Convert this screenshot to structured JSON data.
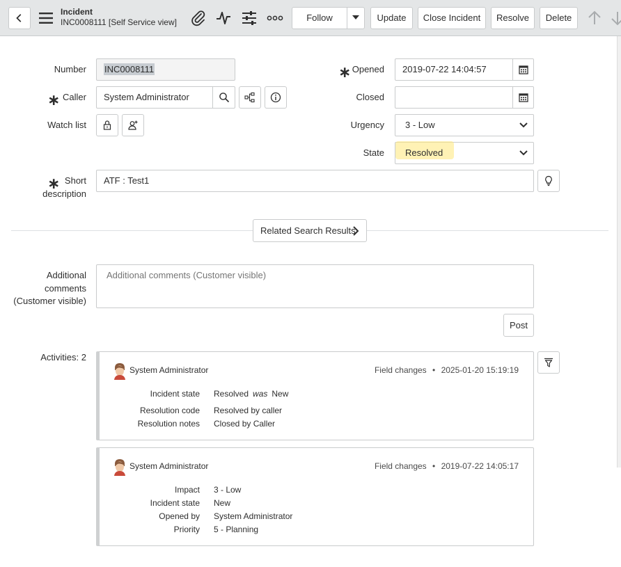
{
  "header": {
    "kind": "Incident",
    "record": "INC0008111 [Self Service view]",
    "buttons": {
      "follow": "Follow",
      "update": "Update",
      "close_incident": "Close Incident",
      "resolve": "Resolve",
      "delete": "Delete"
    }
  },
  "form": {
    "number": {
      "label": "Number",
      "value": "INC0008111"
    },
    "caller": {
      "label": "Caller",
      "value": "System Administrator",
      "required": true
    },
    "watch_list": {
      "label": "Watch list"
    },
    "short_description": {
      "label": "Short description",
      "label_line1": "Short",
      "label_line2": "description",
      "value": "ATF : Test1",
      "required": true
    },
    "opened": {
      "label": "Opened",
      "value": "2019-07-22 14:04:57",
      "required": true
    },
    "closed": {
      "label": "Closed",
      "value": ""
    },
    "urgency": {
      "label": "Urgency",
      "value": "3 - Low"
    },
    "state": {
      "label": "State",
      "value": "Resolved"
    },
    "required_marker": "∗"
  },
  "related_search": {
    "label": "Related Search Results"
  },
  "comments": {
    "label_line1": "Additional",
    "label_line2": "comments",
    "label_line3": "(Customer visible)",
    "placeholder": "Additional comments (Customer visible)",
    "post": "Post"
  },
  "activities": {
    "label": "Activities: 2",
    "entries": [
      {
        "author": "System Administrator",
        "type": "Field changes",
        "separator": "•",
        "timestamp": "2025-01-20 15:19:19",
        "changes": [
          {
            "label": "Incident state",
            "value": "Resolved",
            "was_word": "was",
            "old": "New"
          },
          {
            "label": "Resolution code",
            "value": "Resolved by caller"
          },
          {
            "label": "Resolution notes",
            "value": "Closed by Caller"
          }
        ]
      },
      {
        "author": "System Administrator",
        "type": "Field changes",
        "separator": "•",
        "timestamp": "2019-07-22 14:05:17",
        "changes": [
          {
            "label": "Impact",
            "value": "3 - Low"
          },
          {
            "label": "Incident state",
            "value": "New"
          },
          {
            "label": "Opened by",
            "value": "System Administrator"
          },
          {
            "label": "Priority",
            "value": "5 - Planning"
          }
        ]
      }
    ]
  },
  "colors": {
    "header_bg": "#e4e6e7",
    "border": "#c9cbcc",
    "text": "#2e2e2e",
    "highlight": "#ffe878"
  },
  "icons": [
    "back-icon",
    "menu-icon",
    "attachment-icon",
    "activity-icon",
    "settings-icon",
    "more-icon",
    "chevron-down-icon",
    "arrow-up-icon",
    "arrow-down-icon",
    "calendar-icon",
    "search-icon",
    "hierarchy-icon",
    "info-icon",
    "lock-icon",
    "add-user-icon",
    "lightbulb-icon",
    "chevron-right-icon",
    "filter-icon",
    "avatar"
  ]
}
